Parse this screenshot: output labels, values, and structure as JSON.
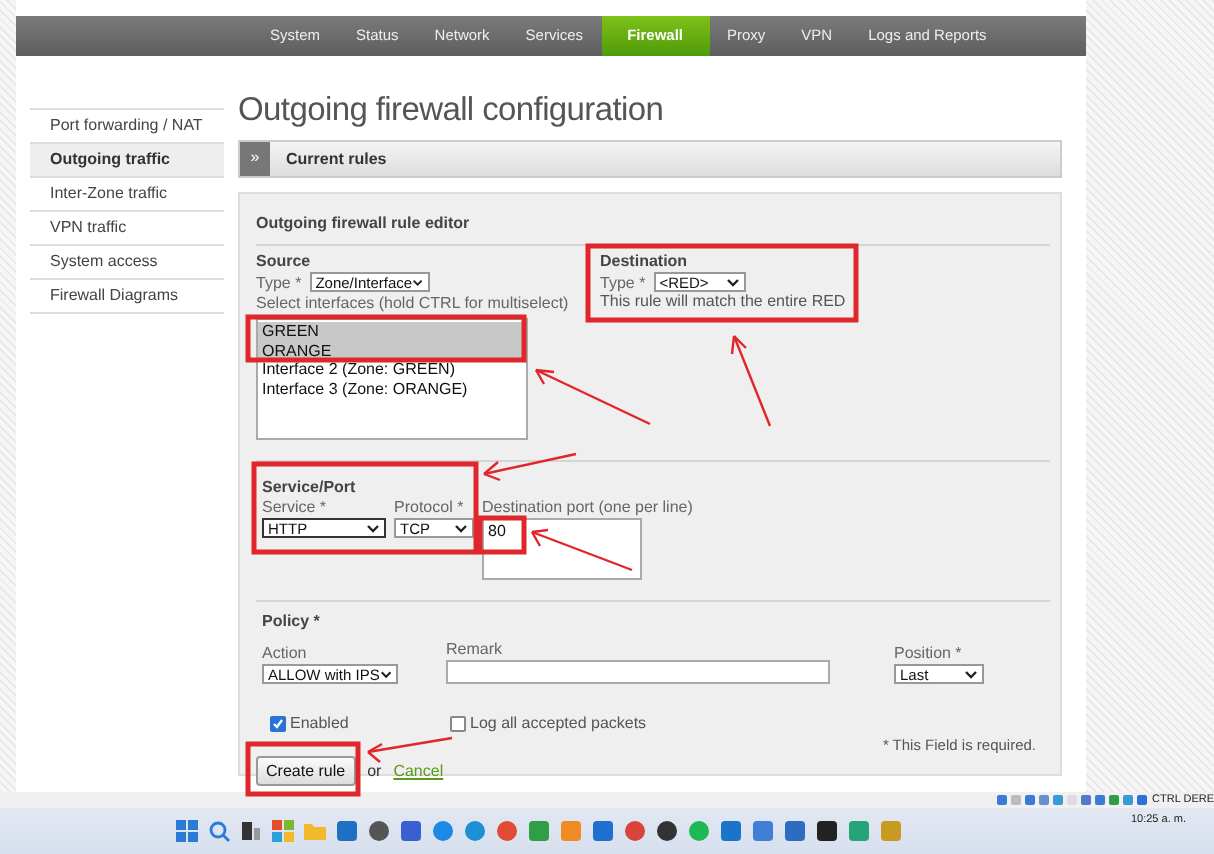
{
  "nav": {
    "items": [
      {
        "label": "System",
        "selected": false
      },
      {
        "label": "Status",
        "selected": false
      },
      {
        "label": "Network",
        "selected": false
      },
      {
        "label": "Services",
        "selected": false
      },
      {
        "label": "Firewall",
        "selected": true
      },
      {
        "label": "Proxy",
        "selected": false
      },
      {
        "label": "VPN",
        "selected": false
      },
      {
        "label": "Logs and Reports",
        "selected": false
      }
    ]
  },
  "sidebar": {
    "items": [
      {
        "label": "Port forwarding / NAT",
        "selected": false
      },
      {
        "label": "Outgoing traffic",
        "selected": true
      },
      {
        "label": "Inter-Zone traffic",
        "selected": false
      },
      {
        "label": "VPN traffic",
        "selected": false
      },
      {
        "label": "System access",
        "selected": false
      },
      {
        "label": "Firewall Diagrams",
        "selected": false
      }
    ]
  },
  "page_title": "Outgoing firewall configuration",
  "current_rules": {
    "toggle": "»",
    "title": "Current rules"
  },
  "editor": {
    "title": "Outgoing firewall rule editor",
    "source": {
      "heading": "Source",
      "type_label": "Type *",
      "type_value": "Zone/Interface",
      "hint": "Select interfaces (hold CTRL for multiselect)",
      "options": [
        {
          "label": "GREEN",
          "selected": true
        },
        {
          "label": "ORANGE",
          "selected": true
        },
        {
          "label": "Interface 2 (Zone: GREEN)",
          "selected": false
        },
        {
          "label": "Interface 3 (Zone: ORANGE)",
          "selected": false
        }
      ]
    },
    "destination": {
      "heading": "Destination",
      "type_label": "Type *",
      "type_value": "<RED>",
      "note": "This rule will match the entire RED"
    },
    "service_port": {
      "heading": "Service/Port",
      "service_label": "Service *",
      "service_value": "HTTP",
      "protocol_label": "Protocol *",
      "protocol_value": "TCP",
      "port_label": "Destination port (one per line)",
      "port_value": "80"
    },
    "policy": {
      "heading": "Policy *",
      "action_label": "Action",
      "action_value": "ALLOW with IPS",
      "remark_label": "Remark",
      "position_label": "Position *",
      "position_value": "Last",
      "enabled": {
        "label": "Enabled",
        "checked": true
      },
      "log": {
        "label": "Log all accepted packets",
        "checked": false
      }
    },
    "create_button": "Create rule",
    "or": "or",
    "cancel": "Cancel",
    "required_note": "* This Field is required."
  },
  "tray": {
    "text": "CTRL DERE"
  },
  "taskbar": {
    "time": "10:25 a. m."
  }
}
